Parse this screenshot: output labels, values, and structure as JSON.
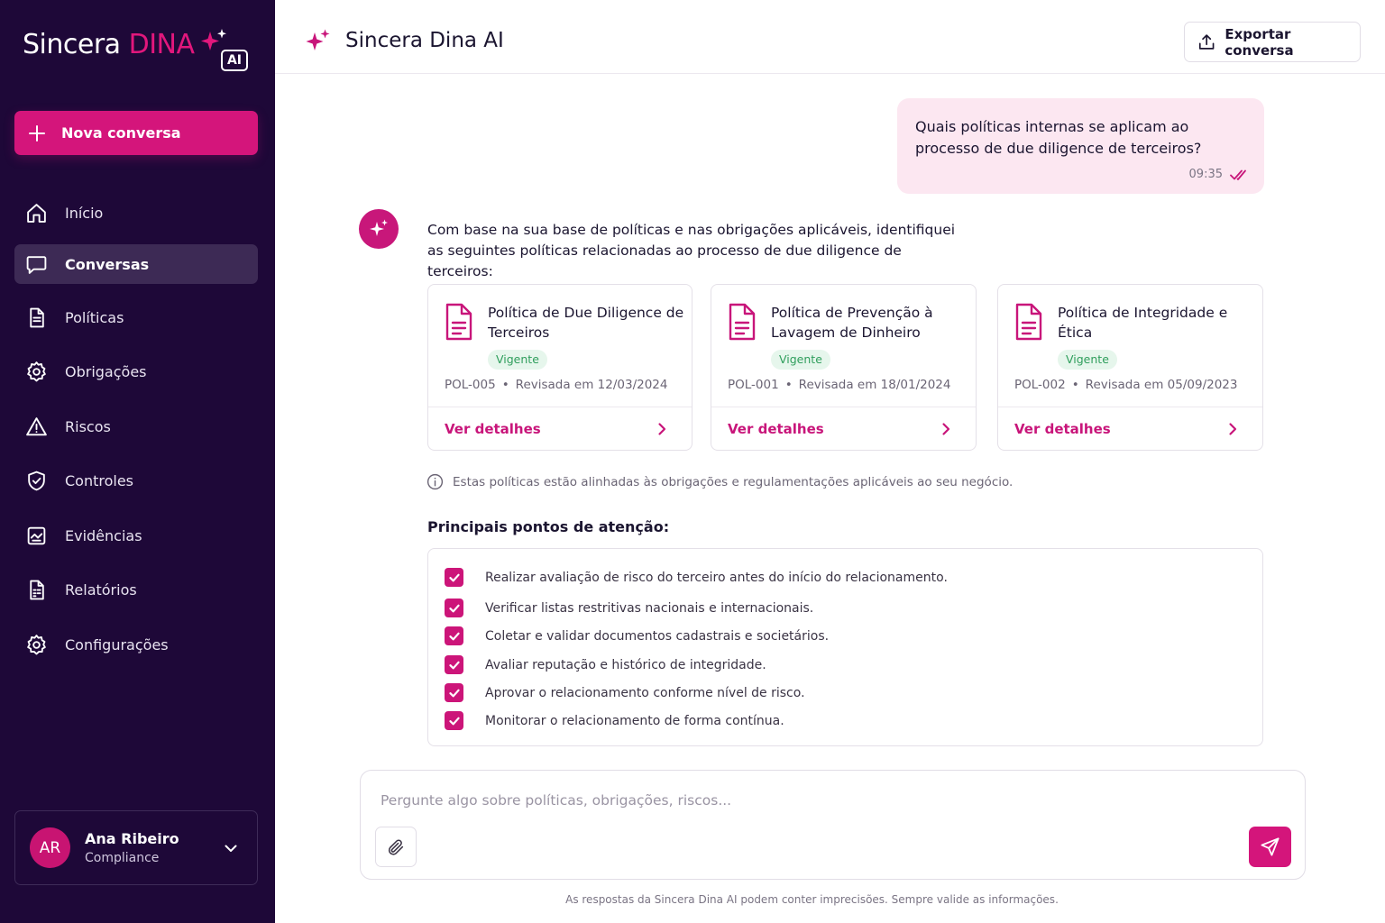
{
  "brand": {
    "name": "Sincera",
    "accent": "DINA",
    "badge": "AI"
  },
  "sidebar": {
    "new_chat_label": "Nova conversa",
    "items": [
      {
        "label": "Início",
        "icon": "home-icon"
      },
      {
        "label": "Conversas",
        "icon": "chat-icon",
        "active": true
      },
      {
        "label": "Políticas",
        "icon": "document-icon"
      },
      {
        "label": "Obrigações",
        "icon": "gear-icon"
      },
      {
        "label": "Riscos",
        "icon": "warning-icon"
      },
      {
        "label": "Controles",
        "icon": "shield-check-icon"
      },
      {
        "label": "Evidências",
        "icon": "evidence-icon"
      },
      {
        "label": "Relatórios",
        "icon": "report-icon"
      },
      {
        "label": "Configurações",
        "icon": "settings-icon"
      }
    ],
    "user": {
      "initials": "AR",
      "name": "Ana Ribeiro",
      "role": "Compliance"
    }
  },
  "header": {
    "title": "Sincera Dina AI",
    "export_label": "Exportar conversa"
  },
  "conversation": {
    "user_message": {
      "text": "Quais políticas internas se aplicam ao processo de due diligence de terceiros?",
      "time": "09:35"
    },
    "assistant_intro": "Com base na sua base de políticas e nas obrigações aplicáveis, identifiquei as seguintes políticas relacionadas ao processo de due diligence de terceiros:",
    "policies": [
      {
        "title": "Política de Due Diligence de Terceiros",
        "status": "Vigente",
        "code": "POL-005",
        "revised": "Revisada em 12/03/2024",
        "link": "Ver detalhes"
      },
      {
        "title": "Política de Prevenção à Lavagem de Dinheiro",
        "status": "Vigente",
        "code": "POL-001",
        "revised": "Revisada em 18/01/2024",
        "link": "Ver detalhes"
      },
      {
        "title": "Política de Integridade e Ética",
        "status": "Vigente",
        "code": "POL-002",
        "revised": "Revisada em 05/09/2023",
        "link": "Ver detalhes"
      }
    ],
    "info_note": "Estas políticas estão alinhadas às obrigações e regulamentações aplicáveis ao seu negócio.",
    "attention_title": "Principais pontos de atenção:",
    "attention_items": [
      "Realizar avaliação de risco do terceiro antes do início do relacionamento.",
      "Verificar listas restritivas nacionais e internacionais.",
      "Coletar e validar documentos cadastrais e societários.",
      "Avaliar reputação e histórico de integridade.",
      "Aprovar o relacionamento conforme nível de risco.",
      "Monitorar o relacionamento de forma contínua."
    ]
  },
  "composer": {
    "placeholder": "Pergunte algo sobre políticas, obrigações, riscos...",
    "value": ""
  },
  "footer": {
    "disclaimer": "As respostas da Sincera Dina AI podem conter imprecisões. Sempre valide as informações."
  },
  "colors": {
    "sidebar_bg": "#1e0838",
    "accent": "#d4157b",
    "user_bubble": "#fce7f1",
    "badge_bg": "#e6f6ec",
    "badge_text": "#2f9e5c"
  }
}
